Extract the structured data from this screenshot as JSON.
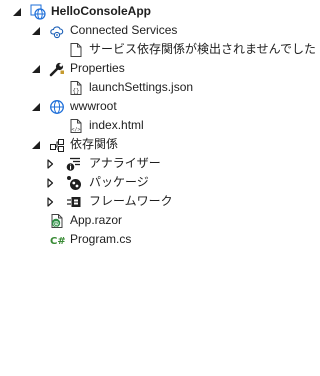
{
  "tree": {
    "project": {
      "label": "HelloConsoleApp",
      "expanded": true,
      "icon": "project-globe-icon"
    },
    "connected_services": {
      "label": "Connected Services",
      "expanded": true,
      "icon": "connected-services-icon",
      "children": [
        {
          "label": "サービス依存関係が検出されませんでした",
          "icon": "document-icon"
        }
      ]
    },
    "properties": {
      "label": "Properties",
      "expanded": true,
      "icon": "wrench-icon",
      "children": [
        {
          "label": "launchSettings.json",
          "icon": "json-file-icon"
        }
      ]
    },
    "wwwroot": {
      "label": "wwwroot",
      "expanded": true,
      "icon": "globe-folder-icon",
      "children": [
        {
          "label": "index.html",
          "icon": "html-file-icon"
        }
      ]
    },
    "dependencies": {
      "label": "依存関係",
      "expanded": true,
      "icon": "dependencies-icon",
      "children": [
        {
          "label": "アナライザー",
          "expanded": false,
          "icon": "analyzer-icon"
        },
        {
          "label": "パッケージ",
          "expanded": false,
          "icon": "package-icon"
        },
        {
          "label": "フレームワーク",
          "expanded": false,
          "icon": "framework-icon"
        }
      ]
    },
    "files": [
      {
        "label": "App.razor",
        "icon": "razor-file-icon"
      },
      {
        "label": "Program.cs",
        "icon": "csharp-file-icon"
      }
    ]
  },
  "colors": {
    "text": "#1e1e1e",
    "chevron": "#1e1e1e",
    "globe_blue": "#1e6fd9",
    "folder_blue": "#1b5fb7",
    "csharp_green": "#388a34",
    "razor_green": "#2f8f46"
  }
}
